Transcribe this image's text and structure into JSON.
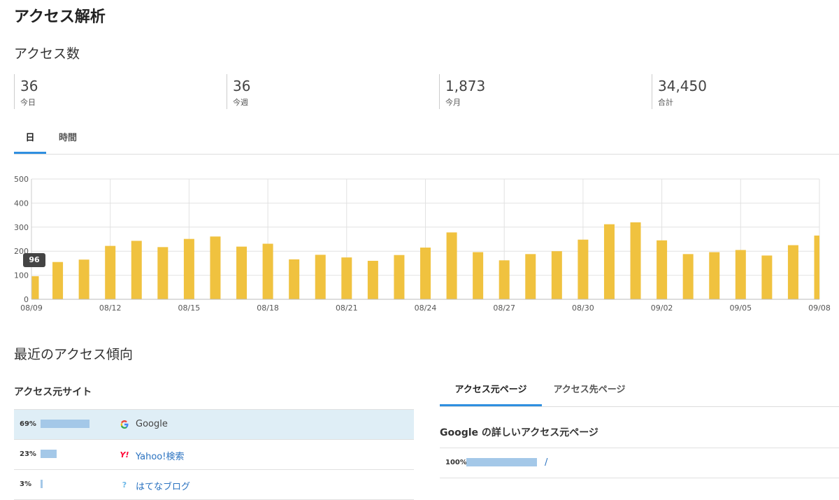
{
  "page_title": "アクセス解析",
  "access_count_title": "アクセス数",
  "stats": [
    {
      "value": "36",
      "label": "今日"
    },
    {
      "value": "36",
      "label": "今週"
    },
    {
      "value": "1,873",
      "label": "今月"
    },
    {
      "value": "34,450",
      "label": "合計"
    }
  ],
  "chart_tabs": [
    {
      "label": "日",
      "active": true
    },
    {
      "label": "時間",
      "active": false
    }
  ],
  "tooltip": "96",
  "chart_data": {
    "type": "bar",
    "categories": [
      "08/09",
      "08/10",
      "08/11",
      "08/12",
      "08/13",
      "08/14",
      "08/15",
      "08/16",
      "08/17",
      "08/18",
      "08/19",
      "08/20",
      "08/21",
      "08/22",
      "08/23",
      "08/24",
      "08/25",
      "08/26",
      "08/27",
      "08/28",
      "08/29",
      "08/30",
      "08/31",
      "09/01",
      "09/02",
      "09/03",
      "09/04",
      "09/05",
      "09/06",
      "09/07",
      "09/08"
    ],
    "values": [
      96,
      155,
      165,
      222,
      243,
      217,
      251,
      261,
      219,
      231,
      166,
      185,
      174,
      160,
      184,
      215,
      278,
      196,
      162,
      188,
      200,
      248,
      312,
      320,
      245,
      188,
      196,
      205,
      182,
      225,
      265
    ],
    "x_tick_labels": [
      "08/09",
      "08/12",
      "08/15",
      "08/18",
      "08/21",
      "08/24",
      "08/27",
      "08/30",
      "09/02",
      "09/05",
      "09/08"
    ],
    "y_ticks": [
      0,
      100,
      200,
      300,
      400,
      500
    ],
    "ylim": [
      0,
      500
    ],
    "bar_color": "#f0c23f",
    "grid": true
  },
  "recent_title": "最近のアクセス傾向",
  "source_sites_title": "アクセス元サイト",
  "source_sites": [
    {
      "pct": "69%",
      "ratio": 0.69,
      "name": "Google",
      "icon": "google-icon"
    },
    {
      "pct": "23%",
      "ratio": 0.23,
      "name": "Yahoo!検索",
      "icon": "yahoo-icon"
    },
    {
      "pct": "3%",
      "ratio": 0.03,
      "name": "はてなブログ",
      "icon": "hatena-icon"
    }
  ],
  "page_tabs": [
    {
      "label": "アクセス元ページ",
      "active": true
    },
    {
      "label": "アクセス先ページ",
      "active": false
    }
  ],
  "detail_title": "Google の詳しいアクセス元ページ",
  "detail_rows": [
    {
      "pct": "100%",
      "ratio": 1.0,
      "path": "/"
    }
  ],
  "colors": {
    "accent": "#2f8fe0",
    "bar": "#f0c23f",
    "ratio_bar": "#a4c8e8",
    "selected_row": "#dfeef6"
  }
}
